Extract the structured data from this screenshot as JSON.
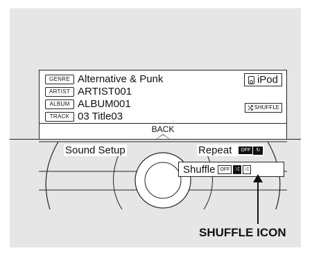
{
  "info": {
    "rows": [
      {
        "tag": "GENRE",
        "value": "Alternative & Punk"
      },
      {
        "tag": "ARTIST",
        "value": "ARTIST001"
      },
      {
        "tag": "ALBUM",
        "value": "ALBUM001"
      },
      {
        "tag": "TRACK",
        "value": "03 Title03"
      }
    ],
    "source_label": "iPod",
    "source_icon": "ipod-icon",
    "shuffle_badge": "SHUFFLE",
    "shuffle_badge_icon": "shuffle-icon"
  },
  "back_label": "BACK",
  "dial": {
    "sound_setup": "Sound Setup",
    "repeat_label": "Repeat",
    "repeat_off": "OFF",
    "repeat_icon": "repeat-icon",
    "shuffle_label": "Shuffle",
    "shuffle_options": [
      {
        "label": "OFF",
        "selected": false
      },
      {
        "label": "⤮",
        "selected": true,
        "icon": "shuffle-icon"
      },
      {
        "label": "⤮",
        "selected": false,
        "icon": "shuffle-all-icon"
      }
    ]
  },
  "callout": "SHUFFLE ICON"
}
